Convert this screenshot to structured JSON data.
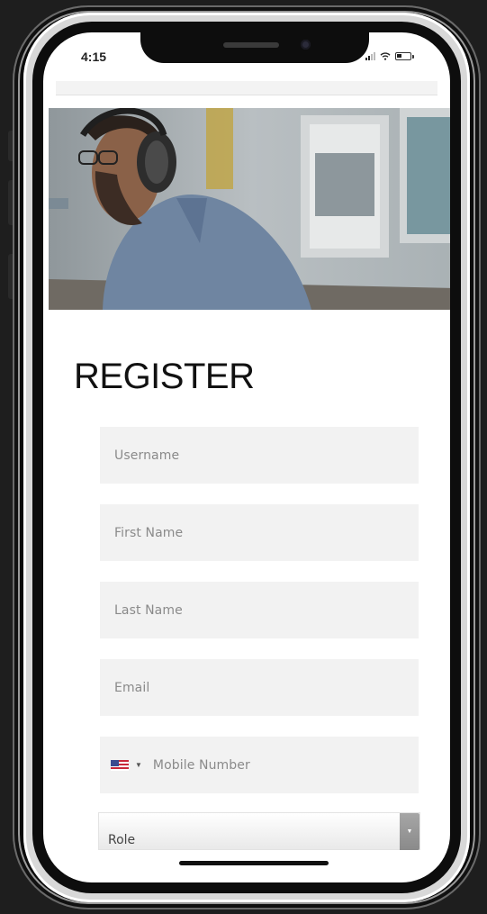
{
  "status_bar": {
    "time": "4:15"
  },
  "page": {
    "title": "REGISTER"
  },
  "form": {
    "username_placeholder": "Username",
    "first_name_placeholder": "First Name",
    "last_name_placeholder": "Last Name",
    "email_placeholder": "Email",
    "mobile_placeholder": "Mobile Number",
    "mobile_country_icon": "us-flag-icon",
    "role_label": "Role"
  },
  "colors": {
    "field_background": "#f2f2f2",
    "placeholder_text": "#8a8a8a",
    "title_text": "#111111"
  }
}
